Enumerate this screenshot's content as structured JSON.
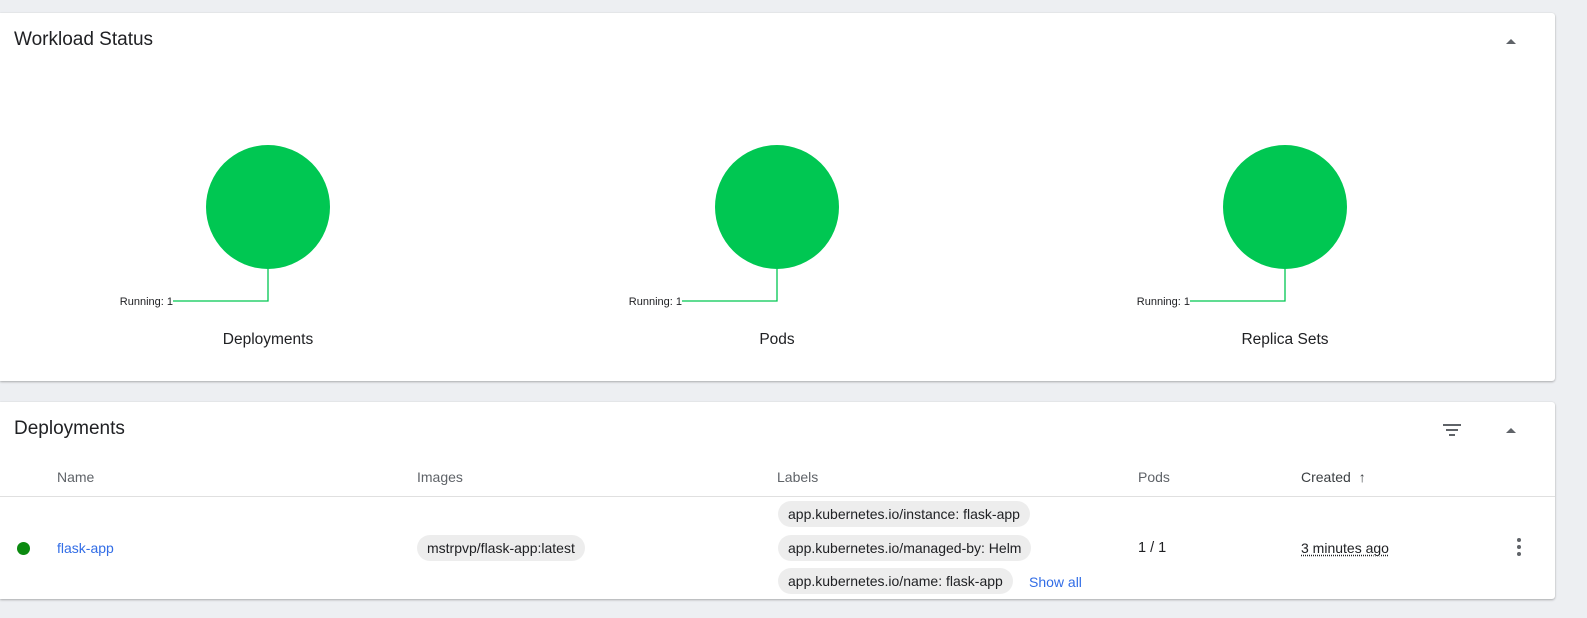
{
  "workload_status": {
    "title": "Workload Status",
    "charts": [
      {
        "caption": "Deployments",
        "legend": "Running: 1",
        "running": 1,
        "color": "#00c752"
      },
      {
        "caption": "Pods",
        "legend": "Running: 1",
        "running": 1,
        "color": "#00c752"
      },
      {
        "caption": "Replica Sets",
        "legend": "Running: 1",
        "running": 1,
        "color": "#00c752"
      }
    ]
  },
  "deployments": {
    "title": "Deployments",
    "columns": {
      "name": "Name",
      "images": "Images",
      "labels": "Labels",
      "pods": "Pods",
      "created": "Created",
      "created_sort": "↑"
    },
    "rows": [
      {
        "status_color": "#0b8a10",
        "name": "flask-app",
        "image": "mstrpvp/flask-app:latest",
        "labels": [
          "app.kubernetes.io/instance: flask-app",
          "app.kubernetes.io/managed-by: Helm",
          "app.kubernetes.io/name: flask-app"
        ],
        "show_all": "Show all",
        "pods": "1 / 1",
        "created": "3 minutes ago"
      }
    ]
  },
  "icons": {
    "collapse": "caret-up-icon",
    "filter": "filter-list-icon",
    "more": "more-vert-icon"
  }
}
